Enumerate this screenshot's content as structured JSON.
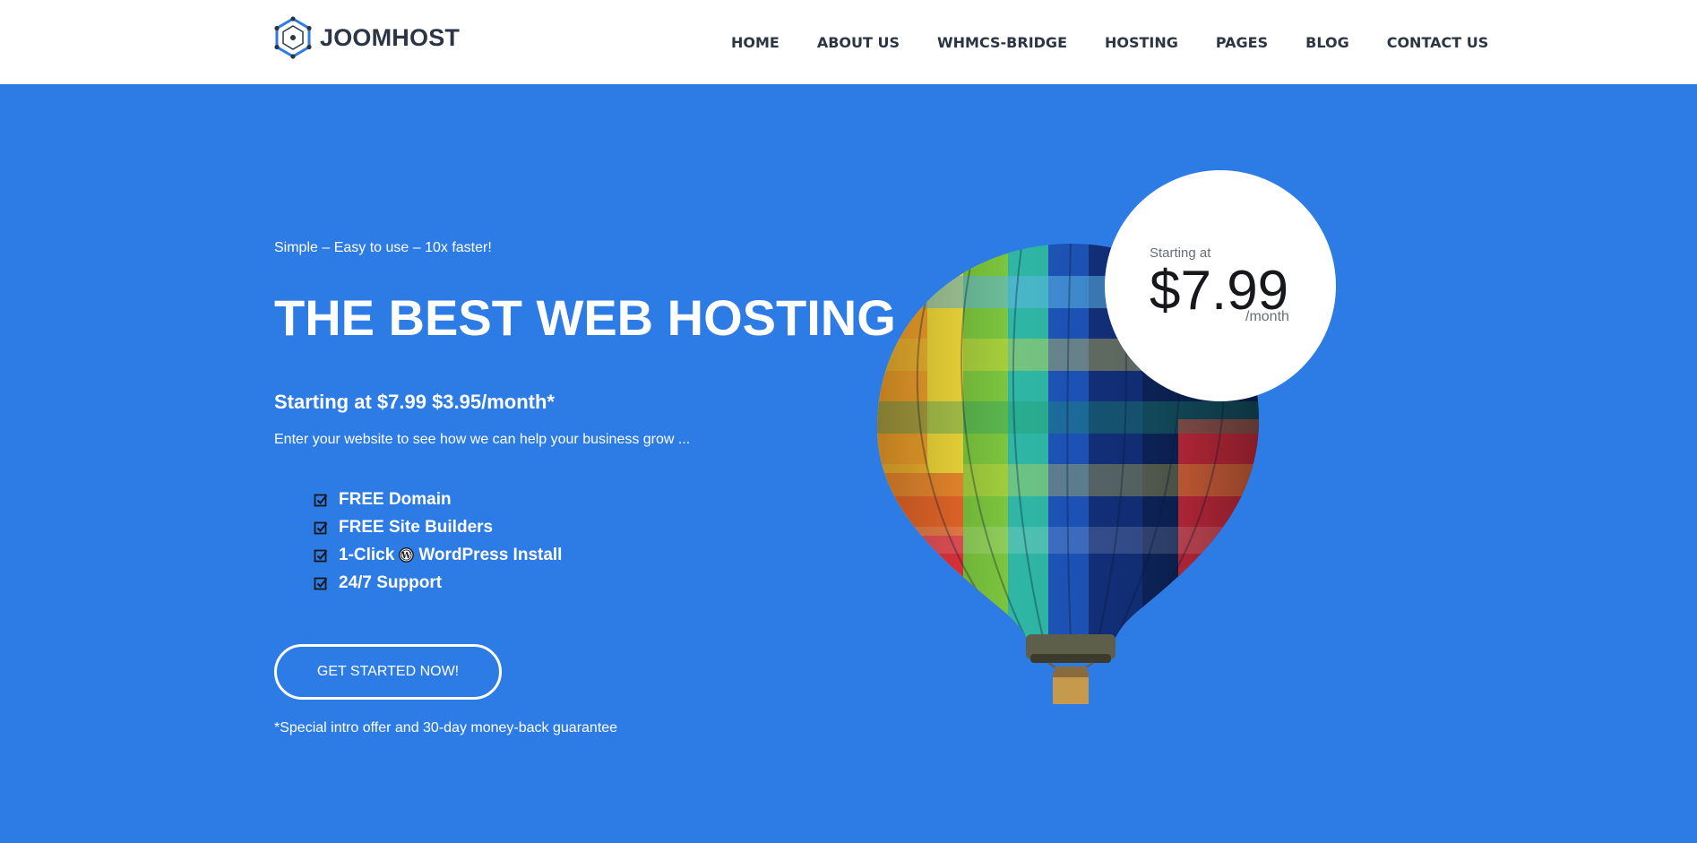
{
  "header": {
    "logo_text": "JOOMHOST",
    "nav": [
      {
        "label": "HOME"
      },
      {
        "label": "ABOUT US"
      },
      {
        "label": "WHMCS-BRIDGE"
      },
      {
        "label": "HOSTING"
      },
      {
        "label": "PAGES"
      },
      {
        "label": "BLOG"
      },
      {
        "label": "CONTACT US"
      }
    ]
  },
  "hero": {
    "tagline": "Simple – Easy to use – 10x faster!",
    "headline": "THE BEST WEB HOSTING",
    "price_line": "Starting at $7.99 $3.95/month*",
    "subtext": "Enter your website to see how we can help your business grow ...",
    "features": [
      {
        "text": "FREE Domain"
      },
      {
        "text": "FREE Site Builders"
      },
      {
        "text_before": "1-Click",
        "text_after": "WordPress Install"
      },
      {
        "text": "24/7 Support"
      }
    ],
    "cta_label": "GET STARTED NOW!",
    "offer_note": "*Special intro offer and 30-day money-back guarantee"
  },
  "price_badge": {
    "starting": "Starting at",
    "price": "$7.99",
    "period": "/month"
  },
  "colors": {
    "background": "#2d7be5",
    "header": "#ffffff",
    "nav_text": "#2b3543",
    "hero_text": "#ffffff"
  },
  "icons": [
    "hexagon-logo-icon",
    "checkbox-icon",
    "wordpress-icon",
    "hot-air-balloon-illustration"
  ]
}
